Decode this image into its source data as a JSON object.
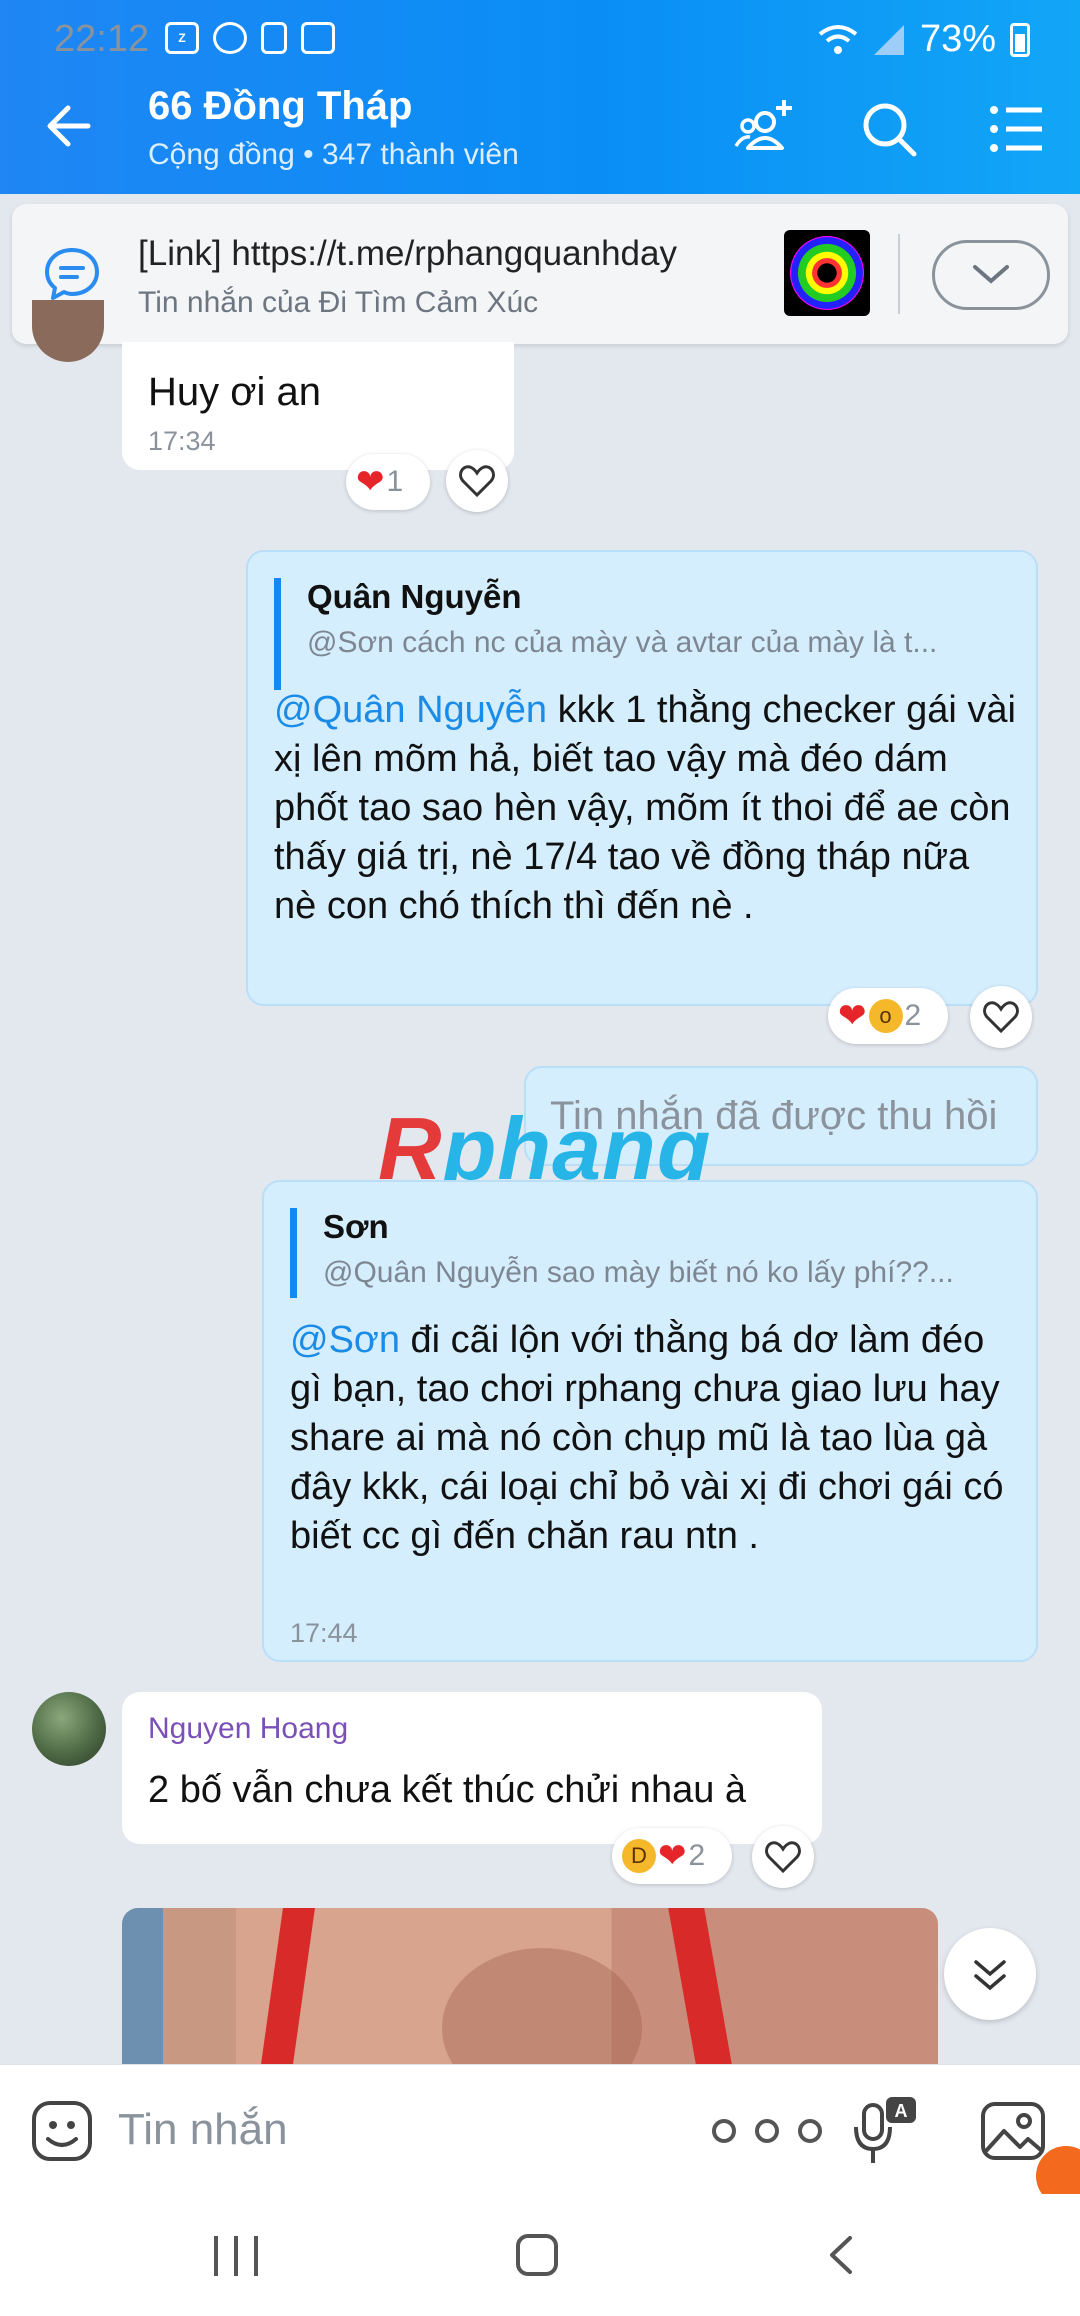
{
  "status_bar": {
    "time": "22:12",
    "battery": "73%",
    "icons": [
      "zalo-icon",
      "pinwheel-icon",
      "lock-icon",
      "image-icon",
      "wifi-icon",
      "signal-icon",
      "battery-icon"
    ]
  },
  "header": {
    "title": "66 Đồng Tháp",
    "subtitle": "Cộng đồng • 347 thành viên"
  },
  "pinned": {
    "title": "[Link] https://t.me/rphangquanhday",
    "subtitle": "Tin nhắn của Đi Tìm Cảm Xúc"
  },
  "messages": [
    {
      "text": "Huy ơi an",
      "time": "17:34",
      "reaction_count": "1"
    },
    {
      "quote_name": "Quân Nguyễn",
      "quote_text": "@Sơn cách nc của mày và avtar của mày là t...",
      "mention": "@Quân Nguyễn",
      "text": " kkk 1 thằng checker gái vài xị lên mõm hả, biết tao vậy mà đéo dám phốt tao sao hèn vậy, mõm ít thoi để ae còn thấy giá trị, nè 17/4 tao về đồng tháp nữa nè con chó thích thì đến nè .",
      "reaction_count": "2"
    },
    {
      "text": "Tin nhắn đã được thu hồi"
    },
    {
      "quote_name": "Sơn",
      "quote_text": "@Quân Nguyễn sao mày biết nó ko lấy phí??...",
      "mention": "@Sơn",
      "text": "  đi cãi lộn với thằng bá dơ làm đéo gì bạn, tao chơi rphang chưa giao lưu hay share ai mà nó còn chụp mũ là tao lùa gà đây kkk, cái loại chỉ bỏ vài xị đi chơi gái có biết cc gì đến chăn rau ntn .",
      "time": "17:44"
    },
    {
      "sender": "Nguyen Hoang",
      "text": "2 bố vẫn chưa kết thúc chửi nhau à",
      "reaction_count": "2"
    }
  ],
  "watermark": {
    "first": "R",
    "rest": "phang"
  },
  "input": {
    "placeholder": "Tin nhắn"
  },
  "colors": {
    "header": "#0a8ef6",
    "outgoing_bubble": "#d5eefe",
    "mention": "#1a8be6",
    "sender_name": "#7b4fb8",
    "reaction_heart": "#e5252a"
  }
}
